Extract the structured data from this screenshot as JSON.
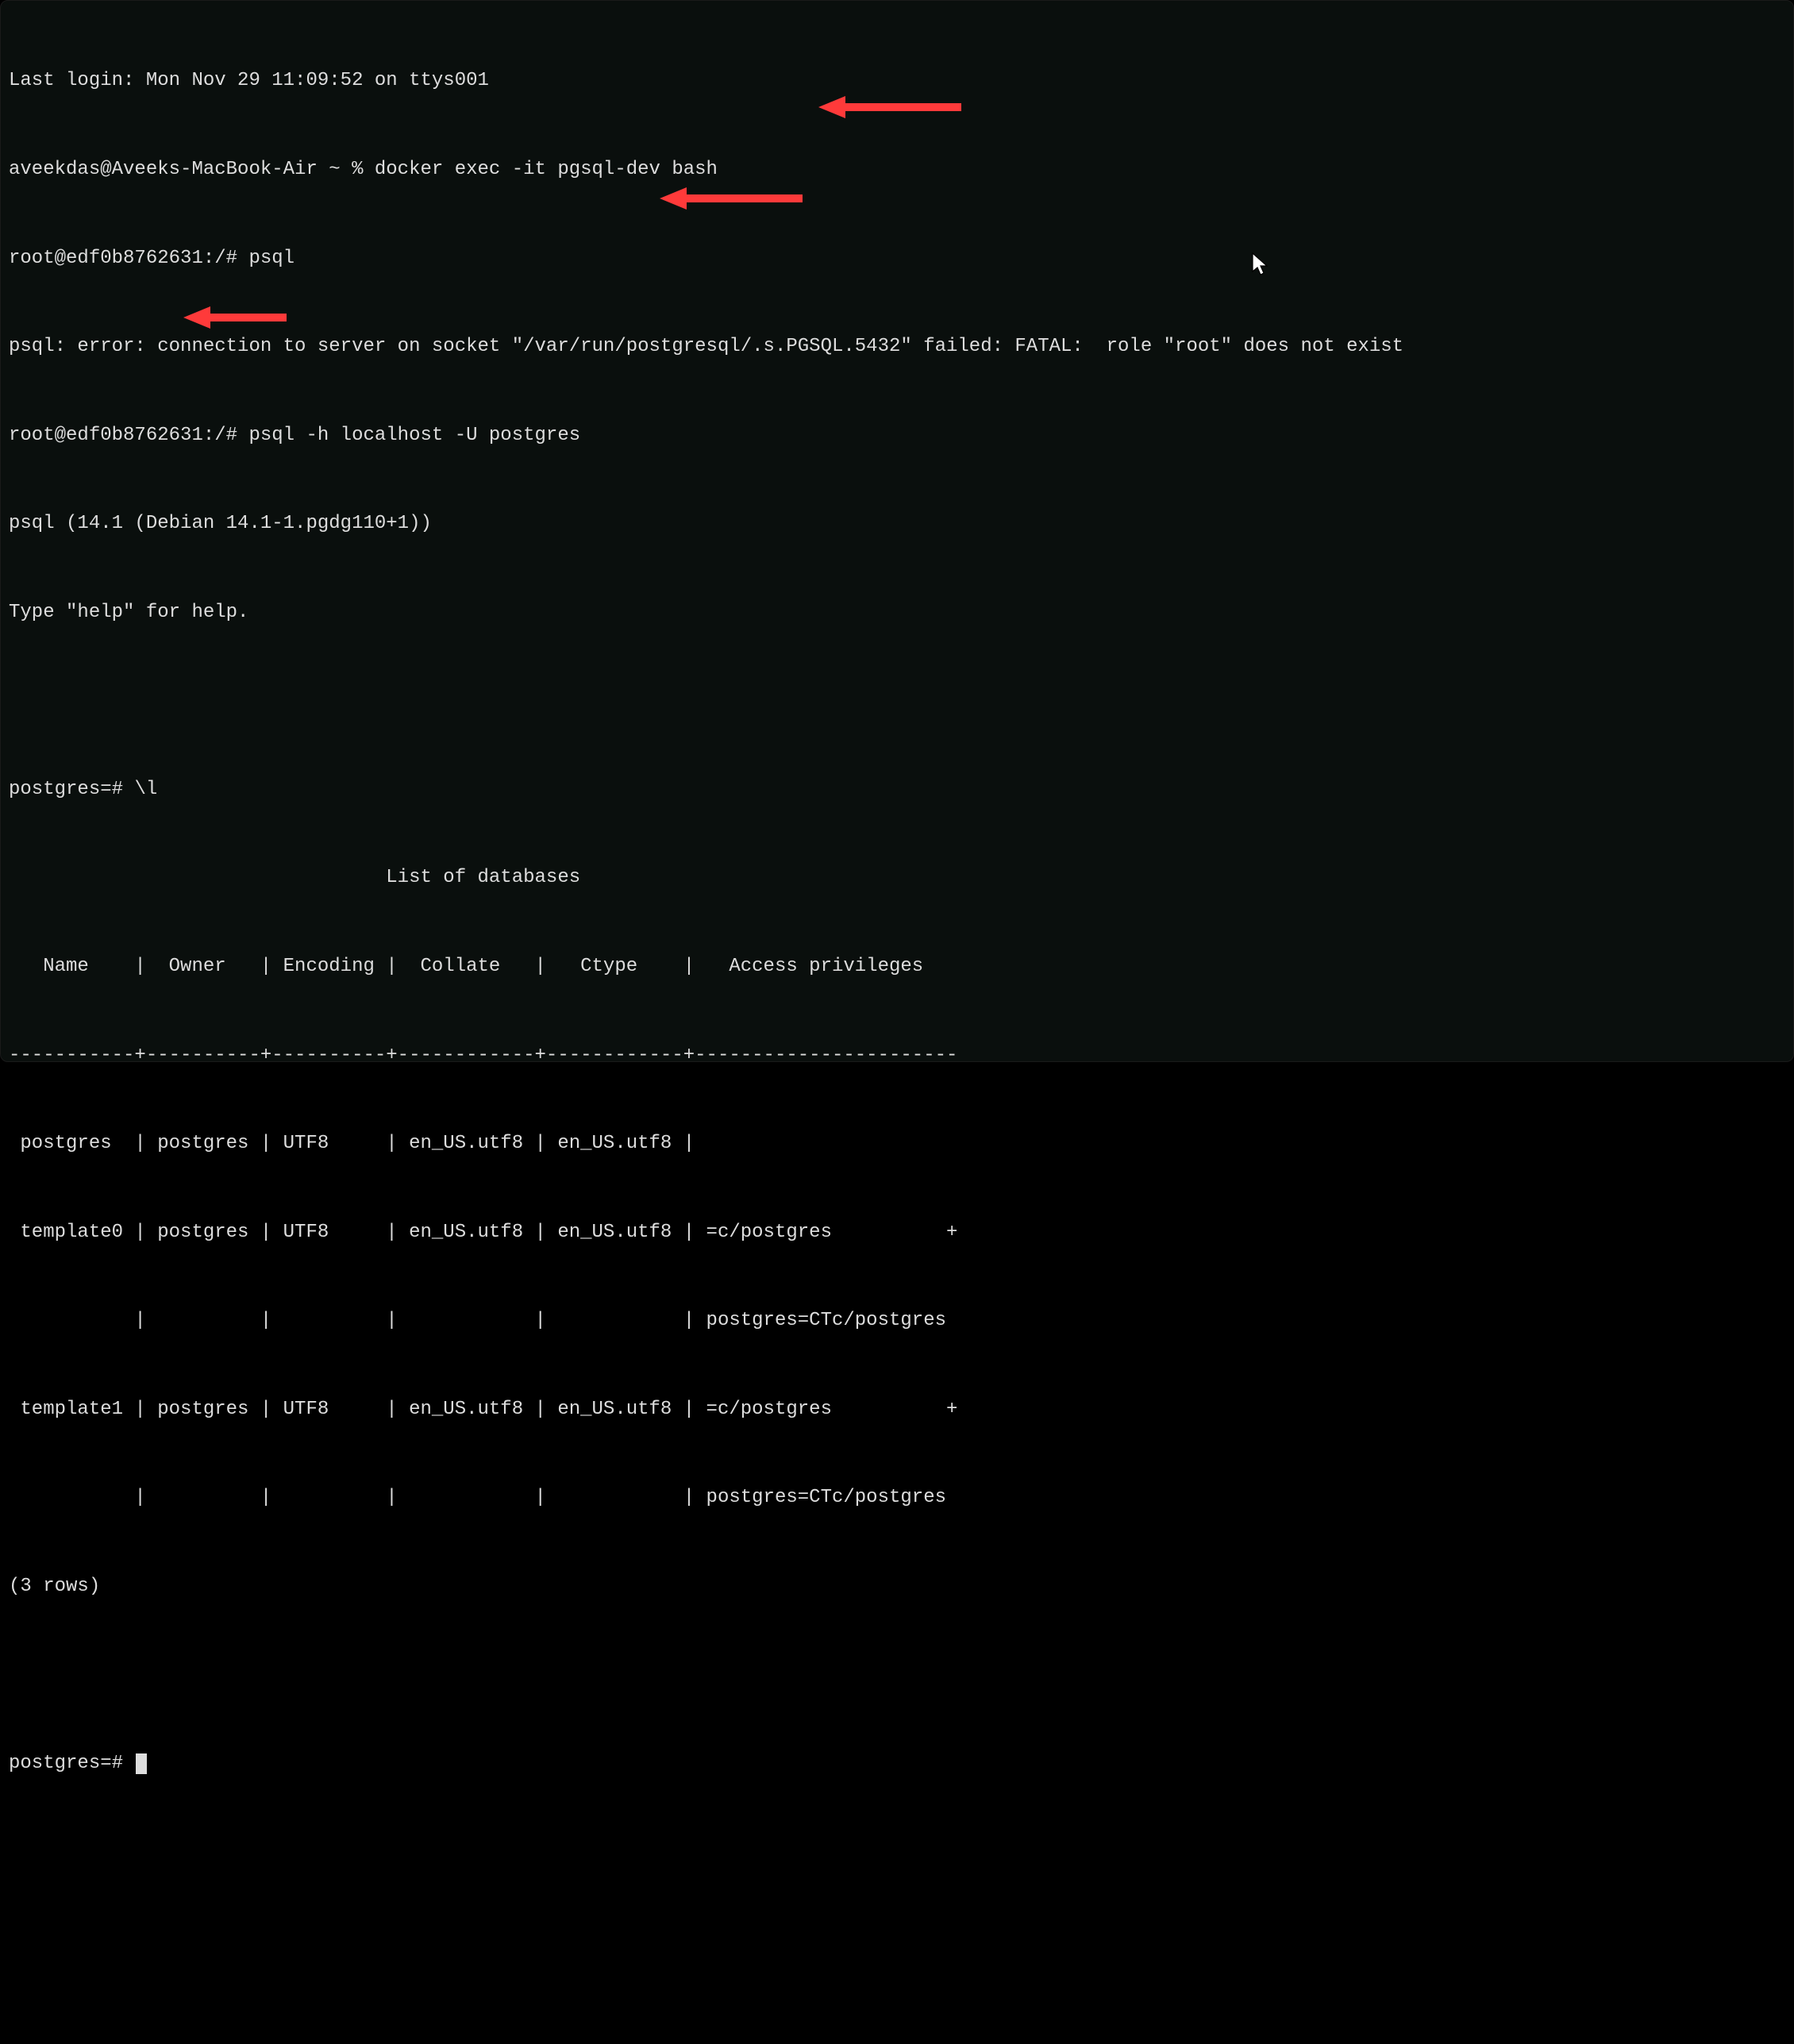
{
  "lines": {
    "last_login": "Last login: Mon Nov 29 11:09:52 on ttys001",
    "host_prompt": "aveekdas@Aveeks-MacBook-Air ~ % ",
    "docker_cmd": "docker exec -it pgsql-dev bash",
    "root_prompt1": "root@edf0b8762631:/# ",
    "psql_cmd1": "psql",
    "psql_error": "psql: error: connection to server on socket \"/var/run/postgresql/.s.PGSQL.5432\" failed: FATAL:  role \"root\" does not exist",
    "root_prompt2": "root@edf0b8762631:/# ",
    "psql_cmd2": "psql -h localhost -U postgres",
    "psql_version": "psql (14.1 (Debian 14.1-1.pgdg110+1))",
    "help_hint": "Type \"help\" for help.",
    "pg_prompt1": "postgres=# ",
    "list_cmd": "\\l",
    "table_title": "                                 List of databases",
    "table_header": "   Name    |  Owner   | Encoding |  Collate   |   Ctype    |   Access privileges   ",
    "table_sep": "-----------+----------+----------+------------+------------+-----------------------",
    "row1": " postgres  | postgres | UTF8     | en_US.utf8 | en_US.utf8 | ",
    "row2a": " template0 | postgres | UTF8     | en_US.utf8 | en_US.utf8 | =c/postgres          +",
    "row2b": "           |          |          |            |            | postgres=CTc/postgres",
    "row3a": " template1 | postgres | UTF8     | en_US.utf8 | en_US.utf8 | =c/postgres          +",
    "row3b": "           |          |          |            |            | postgres=CTc/postgres",
    "rowcount": "(3 rows)",
    "pg_prompt2": "postgres=# "
  },
  "arrows": {
    "color": "#ff3a3a"
  }
}
